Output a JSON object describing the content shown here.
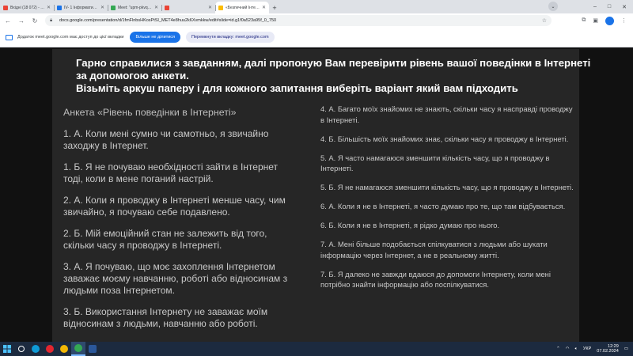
{
  "browser": {
    "tabs": [
      {
        "title": "Вхідні (18 072) - vam@ctpy.vn",
        "favicon_color": "#ea4335",
        "active": false
      },
      {
        "title": "IV- 1 Інформатика 1 курс",
        "favicon_color": "#1a73e8",
        "active": false
      },
      {
        "title": "Meet: \"upm-pkvq-vyq\"",
        "favicon_color": "#34a853",
        "active": false
      },
      {
        "title": "",
        "favicon_color": "#ea4335",
        "active": false
      },
      {
        "title": "«Безпечний Інтернет та с...",
        "favicon_color": "#fbbc04",
        "active": true
      }
    ],
    "new_tab": "+",
    "url": "docs.google.com/presentation/d/1fmFlnbsHKosPtSI_MET4e8huu2k6Xvmkkw/edit#slide=id.g1f0a523a95f_0_750",
    "window_controls": {
      "minimize": "–",
      "maximize": "□",
      "close": "✕"
    }
  },
  "infobar": {
    "message": "Додаток meet.google.com має доступ до цієї вкладки",
    "stop_button": "Більше не ділитися",
    "switch_button": "Перемкнути вкладку: meet.google.com"
  },
  "slide": {
    "heading": [
      "Гарно справилися з завданням, далі пропоную Вам перевірити рівень вашої поведінки в Інтернеті",
      "за допомогою анкети.",
      "Візьміть аркуш паперу і для кожного запитання виберіть варіант який вам підходить"
    ],
    "survey_title": "Анкета «Рівень поведінки в Інтернеті»",
    "left_items": [
      "1. А. Коли мені сумно чи самотньо, я звичайно заходжу в Інтернет.",
      "1. Б. Я не почуваю необхідності зайти в Інтернет тоді, коли в мене поганий настрій.",
      "2. А. Коли я проводжу в Інтернеті менше часу, чим звичайно, я почуваю себе подавлено.",
      "2. Б. Мій емоційний стан не залежить від того, скільки часу я проводжу в Інтернеті.",
      "3. А. Я почуваю, що моє захоплення Інтернетом заважає моєму навчанню, роботі або відносинам з людьми поза Інтернетом.",
      "3. Б. Використання Інтернету не заважає моїм відносинам з людьми, навчанню або роботі."
    ],
    "right_items": [
      "4. А. Багато моїх знайомих не знають, скільки часу я насправді проводжу в Інтернеті.",
      "4. Б. Більшість моїх знайомих знає, скільки часу я проводжу в Інтернеті.",
      "5. А. Я часто намагаюся зменшити кількість часу, що я проводжу в Інтернеті.",
      "5. Б. Я не намагаюся зменшити кількість часу, що я проводжу в Інтернеті.",
      "6. А. Коли я не в Інтернеті, я часто думаю про те, що там відбувається.",
      "6. Б. Коли я не в Інтернеті, я рідко думаю про нього.",
      "7. А. Мені більше подобається спілкуватися з людьми або шукати інформацію через Інтернет, а не в реальному житті.",
      "7. Б. Я далеко не завжди вдаюся до допомоги Інтернету, коли мені потрібно знайти інформацію або поспілкуватися."
    ]
  },
  "taskbar": {
    "apps": [
      {
        "name": "edge",
        "color": "#0f9ad6",
        "active": false
      },
      {
        "name": "opera",
        "color": "#e3262f",
        "active": false
      },
      {
        "name": "chrome",
        "color": "#f2b705",
        "active": false
      },
      {
        "name": "chrome-active",
        "color": "#34a853",
        "active": true
      },
      {
        "name": "word",
        "color": "#2b579a",
        "active": false
      }
    ],
    "language": "УКР",
    "time": "12:29",
    "date": "07.02.2024"
  }
}
